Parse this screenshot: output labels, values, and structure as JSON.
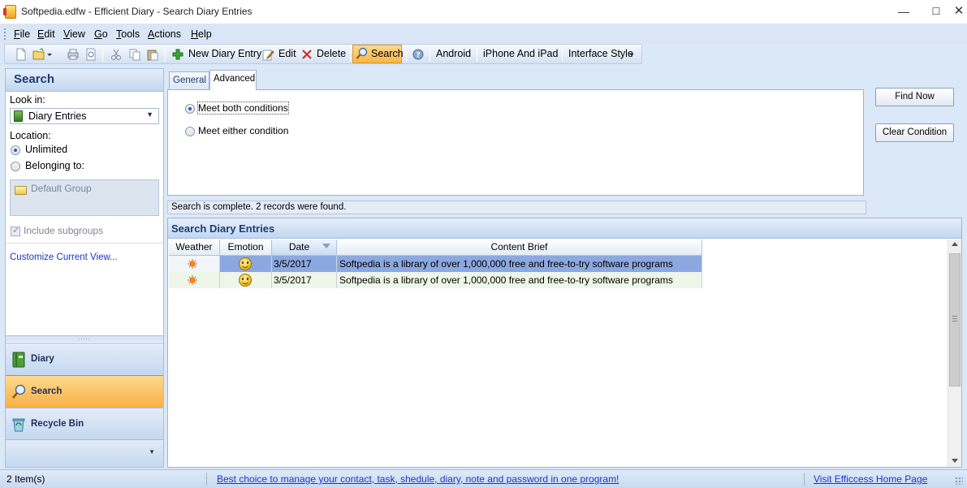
{
  "window": {
    "title": "Softpedia.edfw - Efficient Diary - Search Diary Entries"
  },
  "menu": [
    "File",
    "Edit",
    "View",
    "Go",
    "Tools",
    "Actions",
    "Help"
  ],
  "toolbar": {
    "new_entry": "New Diary Entry",
    "edit": "Edit",
    "delete": "Delete",
    "search": "Search",
    "android": "Android",
    "iphone": "iPhone And iPad",
    "interface_style": "Interface Style"
  },
  "left_panel": {
    "title": "Search",
    "look_in_label": "Look in:",
    "look_in_value": "Diary Entries",
    "location_label": "Location:",
    "unlimited": "Unlimited",
    "belonging_to": "Belonging to:",
    "default_group": "Default Group",
    "include_subgroups": "Include subgroups",
    "customize_link": "Customize Current View..."
  },
  "nav": {
    "diary": "Diary",
    "search": "Search",
    "recycle_bin": "Recycle Bin"
  },
  "tabs": {
    "general": "General",
    "advanced": "Advanced"
  },
  "criteria": {
    "both": "Meet both conditions",
    "either": "Meet either condition"
  },
  "buttons": {
    "find_now": "Find Now",
    "clear_condition": "Clear Condition"
  },
  "status_message": "Search is complete. 2 records were found.",
  "results": {
    "title": "Search Diary Entries",
    "columns": [
      "Weather",
      "Emotion",
      "Date",
      "Content Brief"
    ],
    "rows": [
      {
        "weather": "sun-icon",
        "emotion": "smile-icon",
        "date": "3/5/2017",
        "brief": "Softpedia is a library of over 1,000,000 free and free-to-try software programs"
      },
      {
        "weather": "sun-icon",
        "emotion": "smile-icon",
        "date": "3/5/2017",
        "brief": "Softpedia is a library of over 1,000,000 free and free-to-try software programs"
      }
    ]
  },
  "statusbar": {
    "items": "2 Item(s)",
    "ad": "Best choice to manage your contact, task, shedule, diary, note and password in one program!",
    "home": "Visit Efficcess Home Page"
  },
  "colors": {
    "accent_blue": "#1c3c72",
    "selection": "#8ca8e0",
    "active_orange": "#f7b046"
  }
}
